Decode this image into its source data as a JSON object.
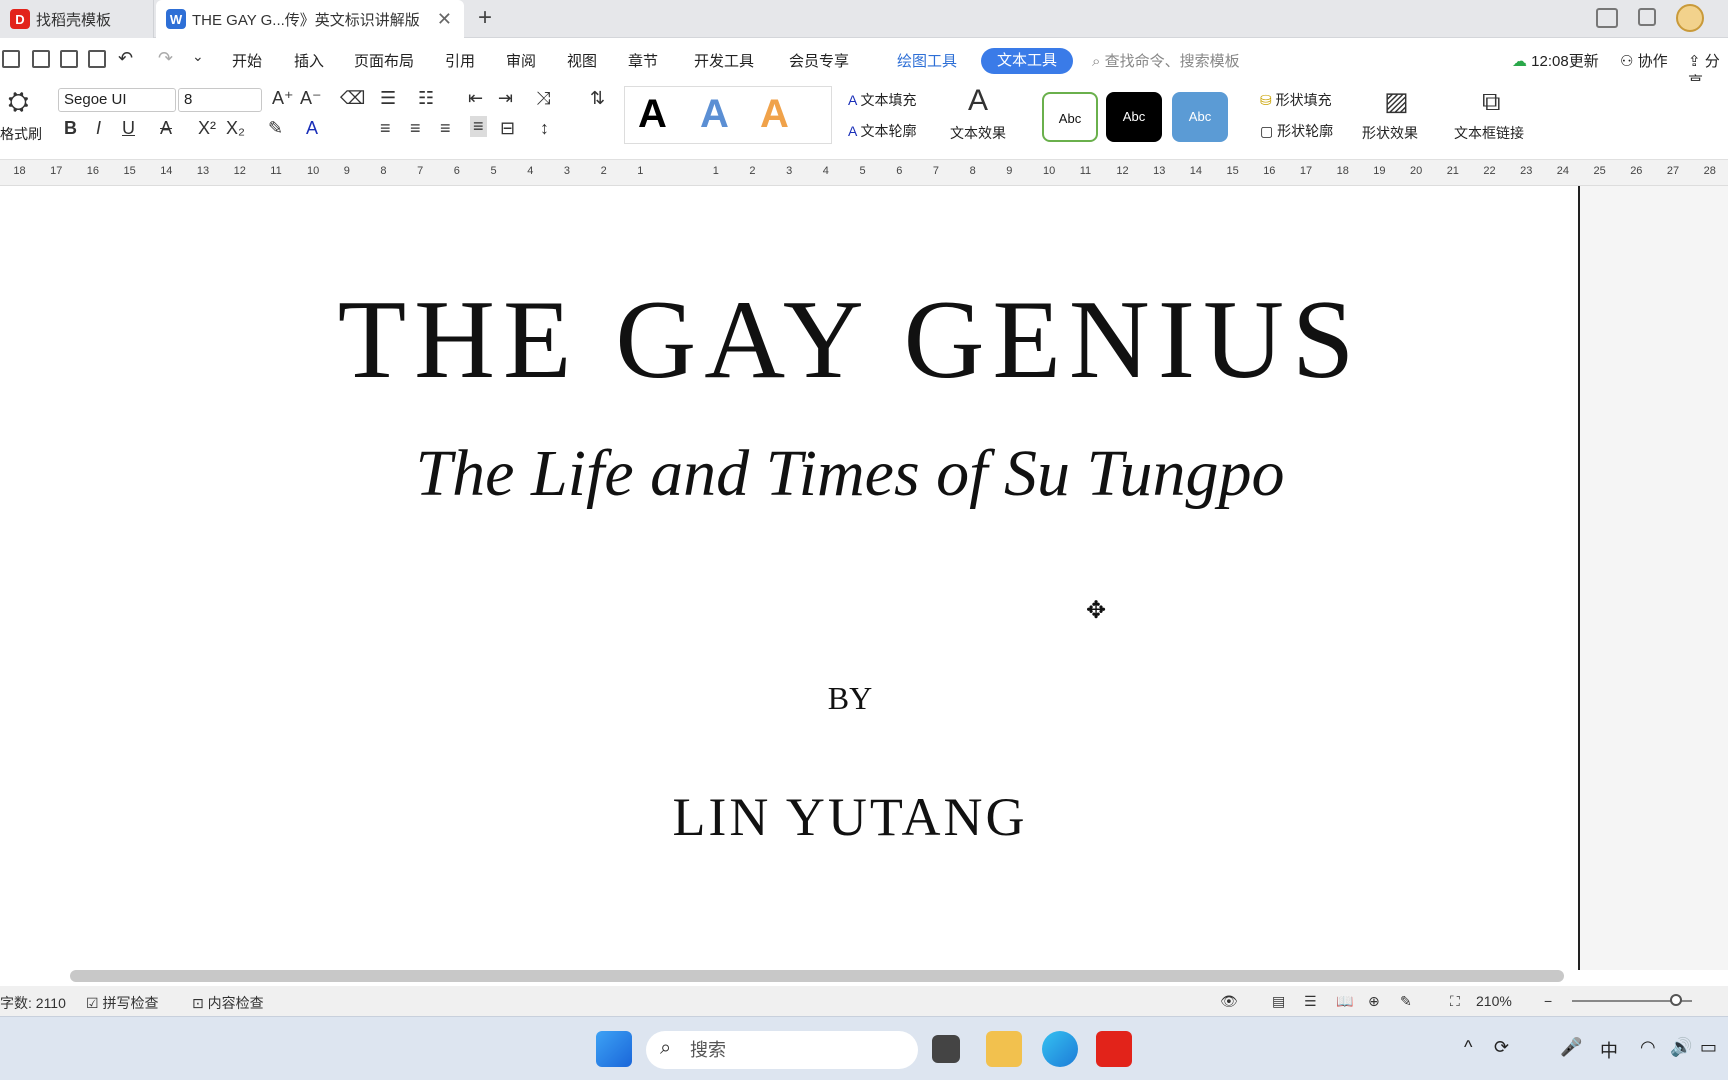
{
  "tabs": {
    "inactive_label": "找稻壳模板",
    "active_label": "THE GAY G...传》英文标识讲解版",
    "new_tab_glyph": "+",
    "close_glyph": "✕"
  },
  "menu": {
    "items": [
      "开始",
      "插入",
      "页面布局",
      "引用",
      "审阅",
      "视图",
      "章节",
      "开发工具",
      "会员专享"
    ],
    "drawing_tool": "绘图工具",
    "text_tool": "文本工具",
    "search_placeholder": "查找命令、搜索模板",
    "update_status": "12:08更新",
    "collab": "协作",
    "share": "分享"
  },
  "ribbon": {
    "format_painter": "格式刷",
    "font_name": "Segoe UI",
    "font_size": "8",
    "text_fill": "文本填充",
    "text_outline": "文本轮廓",
    "text_effect": "文本效果",
    "abc_label": "Abc",
    "shape_fill": "形状填充",
    "shape_outline": "形状轮廓",
    "shape_effect": "形状效果",
    "textbox_link": "文本框链接",
    "style_letter": "A"
  },
  "ruler": {
    "left_labels": [
      "18",
      "17",
      "16",
      "15",
      "14",
      "13",
      "12",
      "11",
      "10",
      "9",
      "8",
      "7",
      "6",
      "5",
      "4",
      "3",
      "2",
      "1"
    ],
    "right_labels": [
      "1",
      "2",
      "3",
      "4",
      "5",
      "6",
      "7",
      "8",
      "9",
      "10",
      "11",
      "12",
      "13",
      "14",
      "15",
      "16",
      "17",
      "18",
      "19",
      "20",
      "21",
      "22",
      "23",
      "24",
      "25",
      "26",
      "27",
      "28"
    ]
  },
  "document": {
    "title": "THE GAY GENIUS",
    "subtitle": "The Life and Times of Su Tungpo",
    "by": "BY",
    "author": "LIN YUTANG"
  },
  "status": {
    "word_count": "字数: 2110",
    "spell_check": "拼写检查",
    "content_check": "内容检查",
    "zoom": "210%"
  },
  "taskbar": {
    "search_placeholder": "搜索",
    "ime": "中"
  },
  "colors": {
    "accent_blue": "#3a7be8",
    "wps_red": "#e2231a"
  }
}
